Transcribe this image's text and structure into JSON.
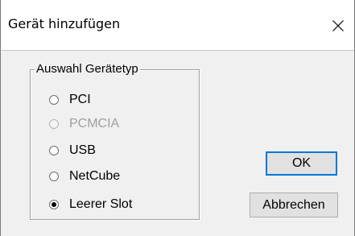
{
  "window": {
    "title": "Gerät hinzufügen",
    "close_icon": "close-icon"
  },
  "group": {
    "legend": "Auswahl Gerätetyp",
    "options": [
      {
        "label": "PCI",
        "checked": false,
        "disabled": false
      },
      {
        "label": "PCMCIA",
        "checked": false,
        "disabled": true
      },
      {
        "label": "USB",
        "checked": false,
        "disabled": false
      },
      {
        "label": "NetCube",
        "checked": false,
        "disabled": false
      },
      {
        "label": "Leerer Slot",
        "checked": true,
        "disabled": false
      }
    ]
  },
  "buttons": {
    "ok_label": "OK",
    "cancel_label": "Abbrechen"
  },
  "colors": {
    "dialog_background": "#f0f0f0",
    "titlebar_background": "#ffffff",
    "button_face": "#e1e1e1",
    "default_button_border": "#0078d7",
    "disabled_text": "#a0a0a0"
  }
}
